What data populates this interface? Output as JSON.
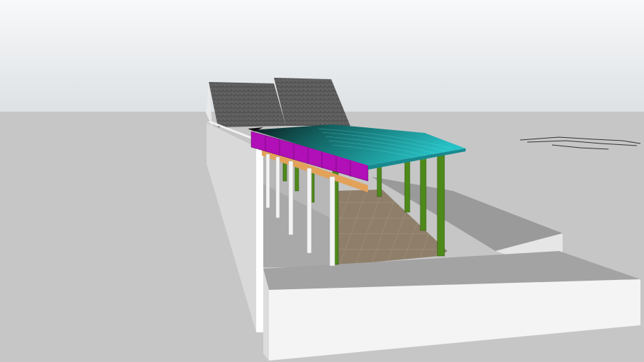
{
  "scene": {
    "description_free": true,
    "colors": {
      "sky_top": "#f8f9fa",
      "sky_bottom": "#dfe3e6",
      "ground": "#c6c6c6",
      "roof_gray": "#5a5a5a",
      "canopy_teal": "#1fa7ad",
      "fascia_magenta": "#b10fb7",
      "column_green": "#4e8a1a",
      "column_white": "#f2f2f2",
      "floor_tan": "#8c7c67",
      "wall_white": "#f4f4f4",
      "slab_gray": "#9c9c9c"
    }
  }
}
